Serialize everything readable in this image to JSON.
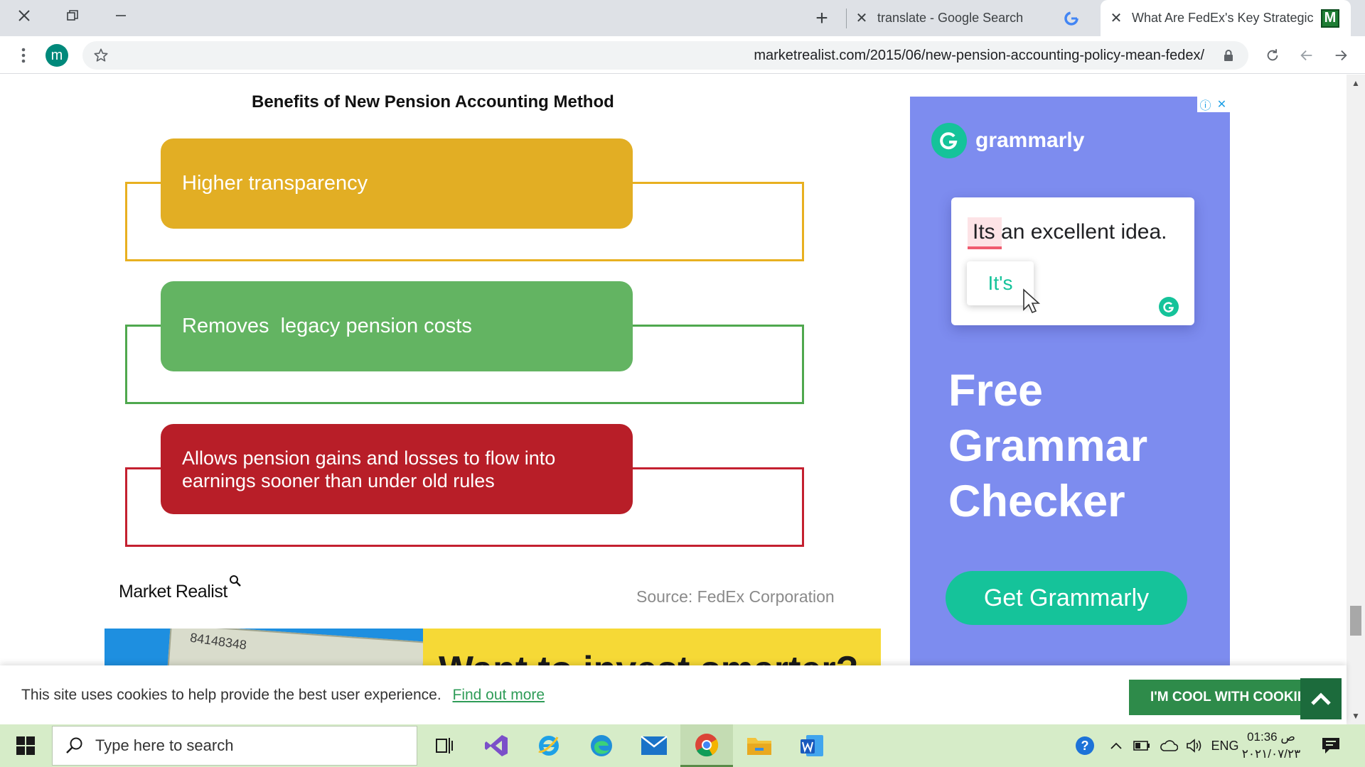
{
  "browser": {
    "tabs": [
      {
        "title": "translate - Google Search",
        "active": false
      },
      {
        "title": "What Are FedEx's Key Strategic B",
        "active": true
      }
    ],
    "url": "marketrealist.com/2015/06/new-pension-accounting-policy-mean-fedex/",
    "profile_initial": "m"
  },
  "article": {
    "chart_title": "Benefits of New Pension Accounting Method",
    "benefits": [
      {
        "lines": [
          "Higher transparency"
        ],
        "color": "#e2ae24",
        "frame_color": "#e8b020"
      },
      {
        "lines": [
          "Removes  legacy pension costs"
        ],
        "color": "#63b462",
        "frame_color": "#4fa84e"
      },
      {
        "lines": [
          "Allows pension gains and losses to flow into",
          "earnings sooner than under old rules"
        ],
        "color": "#b81e28",
        "frame_color": "#c42030"
      }
    ],
    "brand": "Market Realist",
    "source": "Source: FedEx Corporation",
    "banner_text": "Want to invest smarter?",
    "banner_bill_number": "84148348"
  },
  "ad": {
    "brand": "grammarly",
    "sentence": "Its an excellent idea.",
    "suggestion": "It's",
    "headline_lines": [
      "Free",
      "Grammar",
      "Checker"
    ],
    "cta": "Get Grammarly",
    "background": "#7d8cef",
    "accent": "#15c39a"
  },
  "cookie_bar": {
    "message": "This site uses cookies to help provide the best user experience.",
    "link": "Find out more",
    "button": "I'M COOL WITH COOKIES"
  },
  "taskbar": {
    "search_placeholder": "Type here to search",
    "language": "ENG",
    "time": "01:36 ص",
    "date": "٢٠٢١/٠٧/٢٣"
  }
}
